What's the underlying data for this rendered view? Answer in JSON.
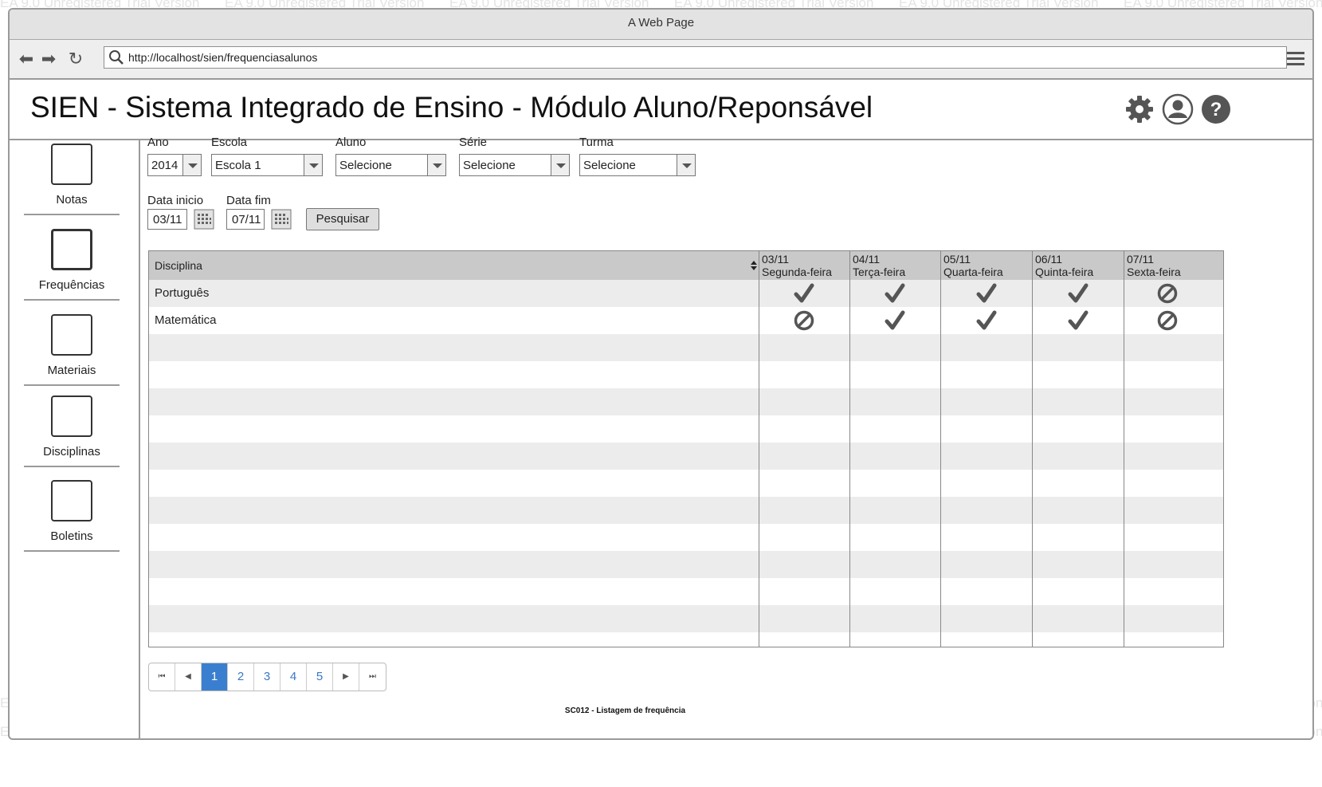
{
  "watermark": "EA 9.0 Unregistered Trial Version",
  "window": {
    "title": "A Web Page"
  },
  "browser": {
    "url": "http://localhost/sien/frequenciasalunos"
  },
  "app": {
    "title": "SIEN - Sistema Integrado de Ensino - Módulo Aluno/Reponsável"
  },
  "icons": {
    "settings": "gear-icon",
    "user": "user-icon",
    "help": "help-icon"
  },
  "sidebar": {
    "items": [
      {
        "label": "Notas"
      },
      {
        "label": "Frequências",
        "active": true
      },
      {
        "label": "Materiais"
      },
      {
        "label": "Disciplinas"
      },
      {
        "label": "Boletins"
      }
    ]
  },
  "filters": {
    "ano": {
      "label": "Ano",
      "value": "2014"
    },
    "escola": {
      "label": "Escola",
      "value": "Escola 1"
    },
    "aluno": {
      "label": "Aluno",
      "value": "Selecione"
    },
    "serie": {
      "label": "Série",
      "value": "Selecione"
    },
    "turma": {
      "label": "Turma",
      "value": "Selecione"
    },
    "data_inicio": {
      "label": "Data inicio",
      "value": "03/11"
    },
    "data_fim": {
      "label": "Data fim",
      "value": "07/11"
    },
    "search_label": "Pesquisar"
  },
  "table": {
    "discipline_header": "Disciplina",
    "days": [
      {
        "date": "03/11",
        "weekday": "Segunda-feira"
      },
      {
        "date": "04/11",
        "weekday": "Terça-feira"
      },
      {
        "date": "05/11",
        "weekday": "Quarta-feira"
      },
      {
        "date": "06/11",
        "weekday": "Quinta-feira"
      },
      {
        "date": "07/11",
        "weekday": "Sexta-feira"
      }
    ],
    "rows": [
      {
        "discipline": "Português",
        "attendance": [
          "check",
          "check",
          "check",
          "check",
          "absent"
        ]
      },
      {
        "discipline": "Matemática",
        "attendance": [
          "absent",
          "check",
          "check",
          "check",
          "absent"
        ]
      }
    ]
  },
  "pagination": {
    "pages": [
      "1",
      "2",
      "3",
      "4",
      "5"
    ],
    "current": "1"
  },
  "caption": "SC012 - Listagem de frequência"
}
